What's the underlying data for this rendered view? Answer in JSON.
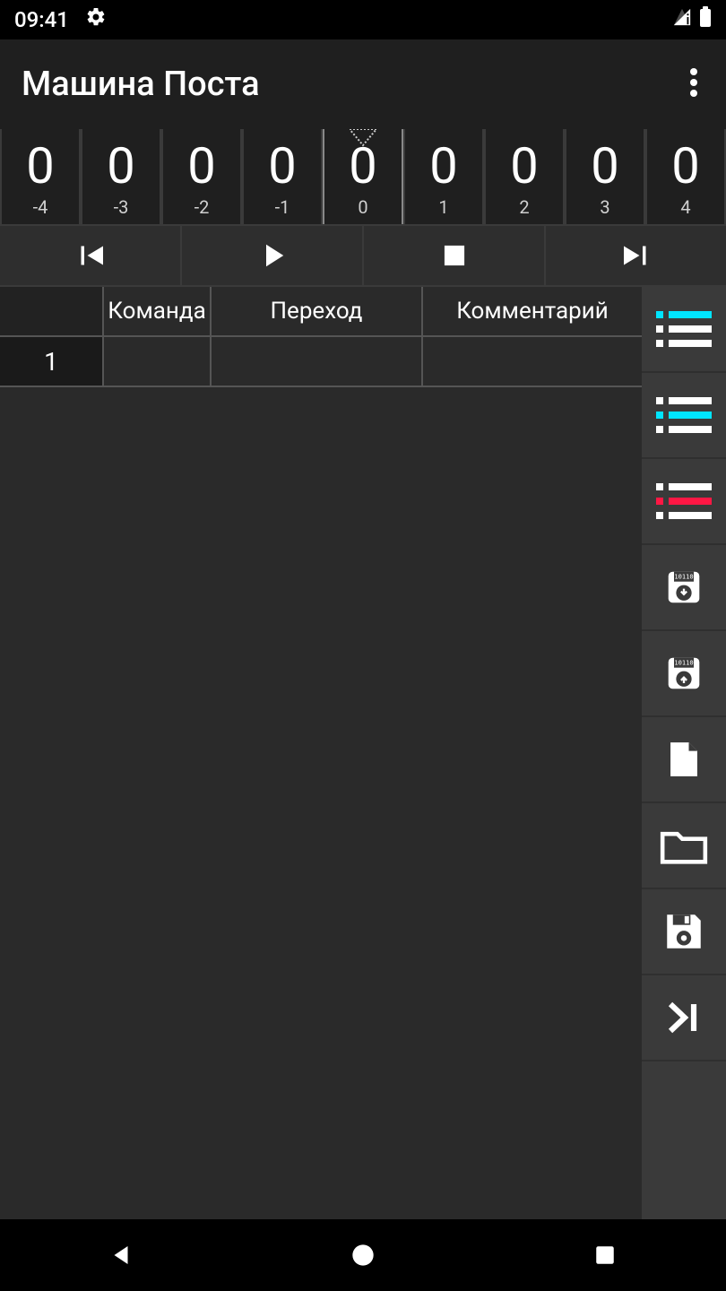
{
  "status": {
    "time": "09:41"
  },
  "app": {
    "title": "Машина Поста"
  },
  "tape": {
    "cells": [
      {
        "value": "0",
        "index": "-4"
      },
      {
        "value": "0",
        "index": "-3"
      },
      {
        "value": "0",
        "index": "-2"
      },
      {
        "value": "0",
        "index": "-1"
      },
      {
        "value": "0",
        "index": "0",
        "active": true
      },
      {
        "value": "0",
        "index": "1"
      },
      {
        "value": "0",
        "index": "2"
      },
      {
        "value": "0",
        "index": "3"
      },
      {
        "value": "0",
        "index": "4"
      }
    ]
  },
  "controls": {
    "rewind": "skip-previous",
    "play": "play",
    "stop": "stop",
    "forward": "skip-next"
  },
  "table": {
    "headers": {
      "command": "Команда",
      "jump": "Переход",
      "comment": "Комментарий"
    },
    "rows": [
      {
        "num": "1",
        "command": "",
        "jump": "",
        "comment": ""
      }
    ]
  },
  "sidebar": {
    "buttons": [
      "list-add-row",
      "list-insert-row",
      "list-delete-row",
      "load-binary",
      "save-binary",
      "new-file",
      "open-folder",
      "save-file",
      "go-last"
    ]
  }
}
